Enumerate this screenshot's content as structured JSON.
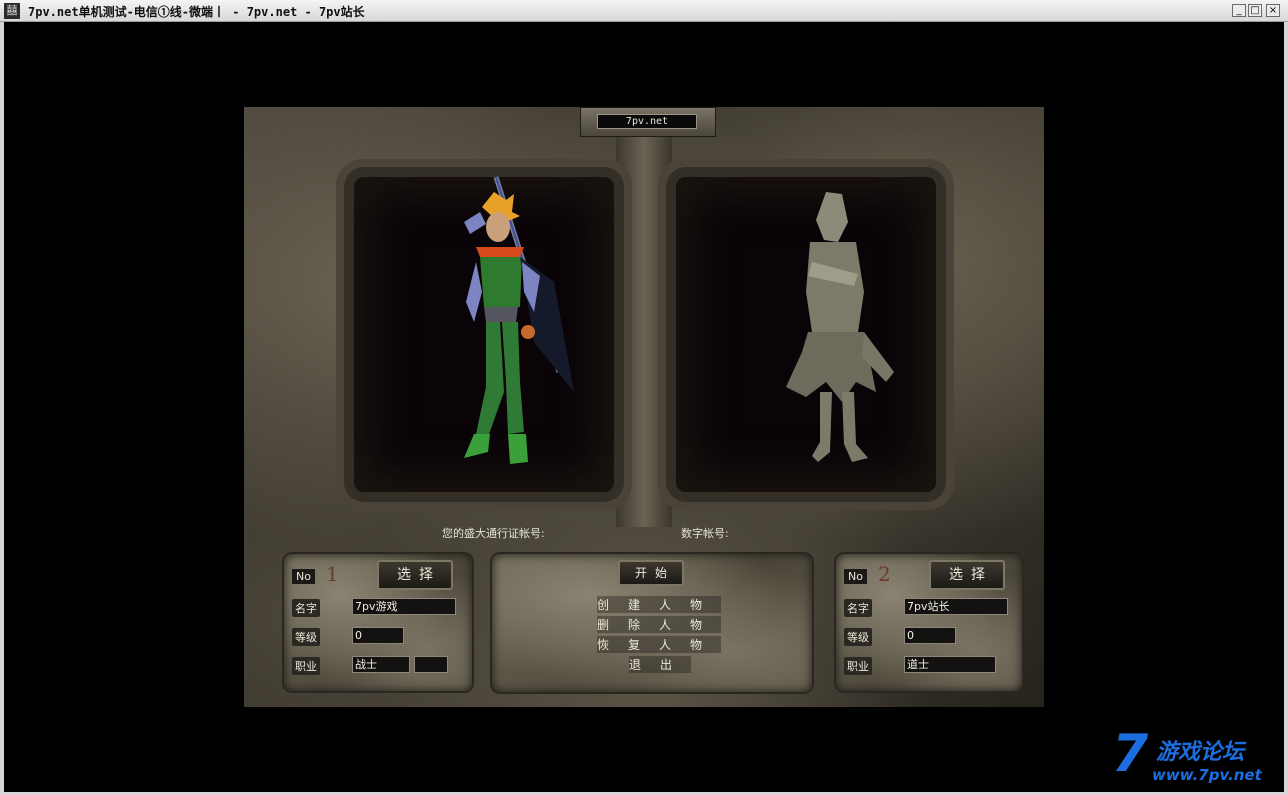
{
  "window": {
    "title": "7pv.net单机测试-电信①线-微端丨 - 7pv.net - 7pv站长",
    "icon": "app-icon",
    "minimize": "_",
    "maximize": "□",
    "close": "×"
  },
  "server_label": "7pv.net",
  "account": {
    "shanda_label": "您的盛大通行证帐号:",
    "digital_label": "数字帐号:"
  },
  "slot1": {
    "no_label": "No",
    "number": "1",
    "select_button": "选择",
    "name_label": "名字",
    "name_value": "7pv游戏",
    "level_label": "等级",
    "level_value": "0",
    "job_label": "职业",
    "job_value": "战士"
  },
  "slot2": {
    "no_label": "No",
    "number": "2",
    "select_button": "选择",
    "name_label": "名字",
    "name_value": "7pv站长",
    "level_label": "等级",
    "level_value": "0",
    "job_label": "职业",
    "job_value": "道士"
  },
  "menu": {
    "start": "开始",
    "create": "创建人物",
    "delete": "删除人物",
    "restore": "恢复人物",
    "exit": "退出"
  },
  "watermark": {
    "logo": "7",
    "name": "游戏论坛",
    "url": "www.7pv.net",
    "color": "#1c6ee0"
  }
}
